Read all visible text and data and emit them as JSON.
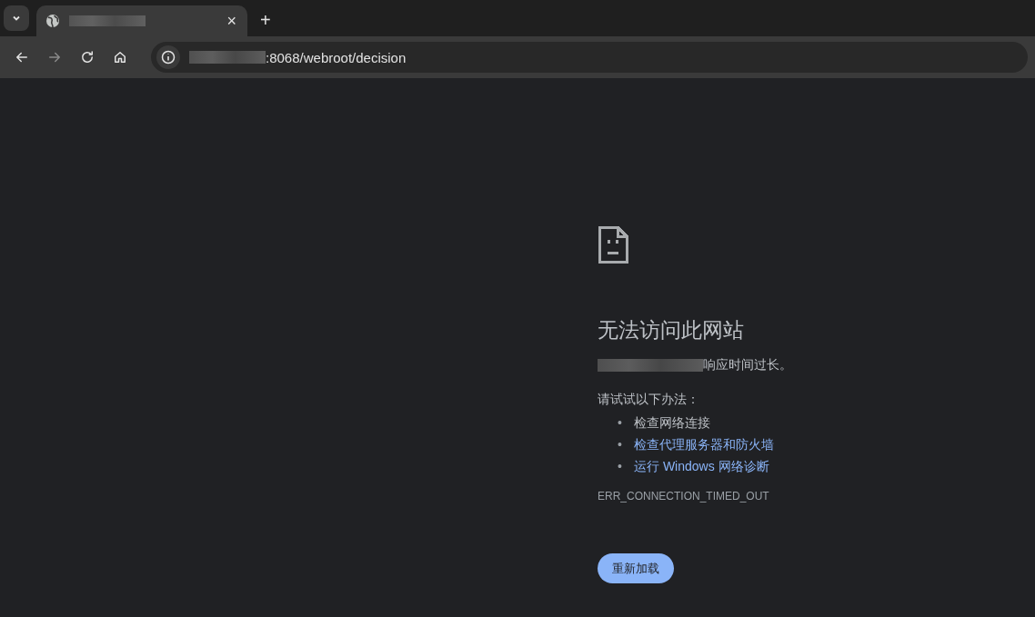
{
  "tab": {
    "selected": true,
    "close": "×"
  },
  "new_tab": "+",
  "address": {
    "url": ":8068/webroot/decision"
  },
  "error": {
    "title": "无法访问此网站",
    "message": "响应时间过长。",
    "suggestions_heading": "请试试以下办法：",
    "suggestions": [
      {
        "kind": "text",
        "bullet": "•",
        "label": "检查网络连接"
      },
      {
        "kind": "link",
        "bullet": "•",
        "label": "检查代理服务器和防火墙"
      },
      {
        "kind": "link",
        "bullet": "•",
        "label": "运行 Windows 网络诊断"
      }
    ],
    "code": "ERR_CONNECTION_TIMED_OUT",
    "button": "重新加载"
  }
}
